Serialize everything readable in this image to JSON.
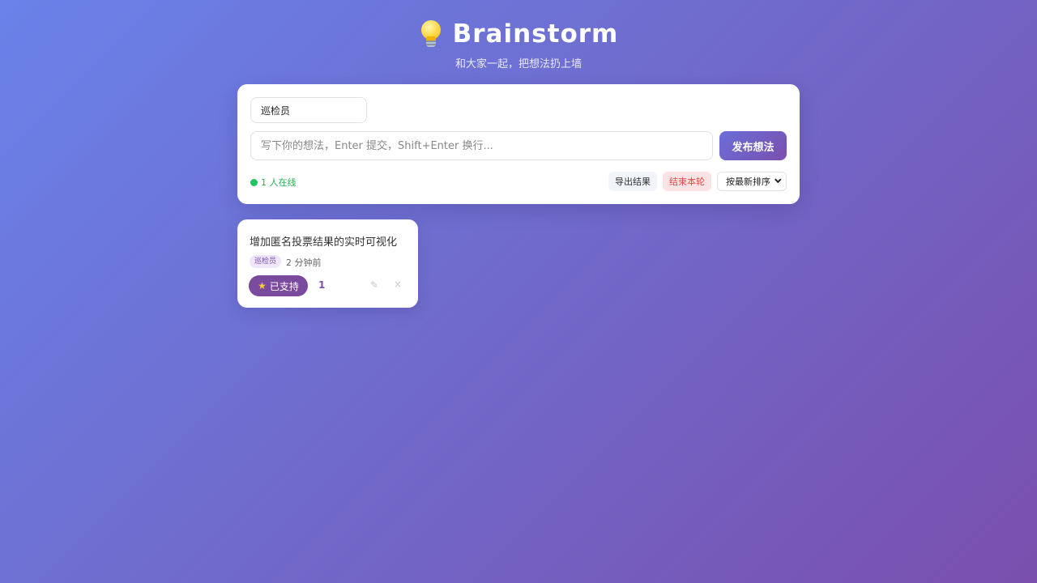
{
  "header": {
    "title": "Brainstorm",
    "subtitle": "和大家一起，把想法扔上墙",
    "icon": "lightbulb-icon"
  },
  "composer": {
    "name_value": "巡检员",
    "idea_placeholder": "写下你的想法，Enter 提交，Shift+Enter 换行...",
    "publish_label": "发布想法",
    "online_text": "1 人在线",
    "export_label": "导出结果",
    "end_round_label": "结束本轮",
    "sort_selected": "按最新排序"
  },
  "ideas": [
    {
      "text": "增加匿名投票结果的实时可视化",
      "author": "巡检员",
      "time": "2 分钟前",
      "support_label": "已支持",
      "votes": "1",
      "edit_icon": "✎",
      "delete_icon": "×"
    }
  ],
  "colors": {
    "accent": "#7a4fae",
    "online": "#22c55e",
    "danger": "#e04848"
  }
}
